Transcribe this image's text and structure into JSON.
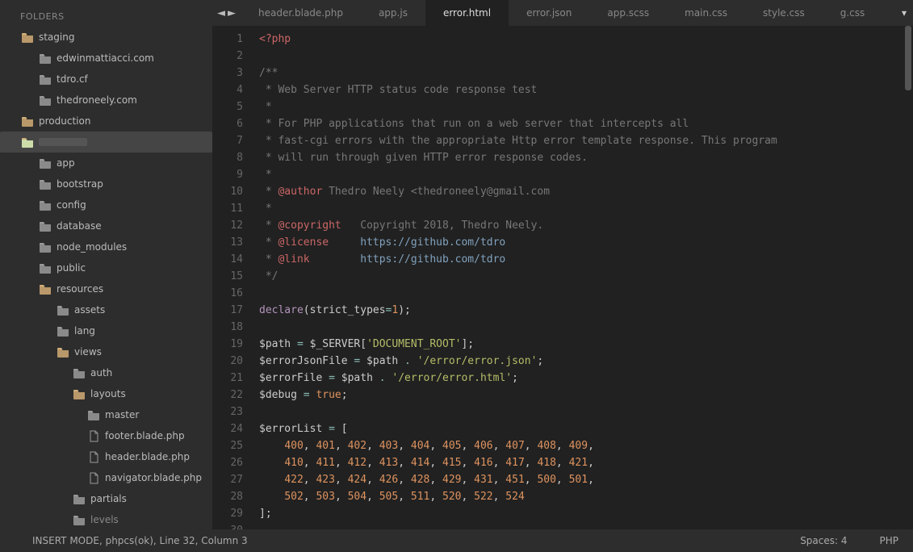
{
  "sidebar": {
    "title": "FOLDERS",
    "tree": [
      {
        "indent": 1,
        "type": "folder",
        "open": true,
        "label": "staging"
      },
      {
        "indent": 2,
        "type": "folder",
        "open": false,
        "label": "edwinmattiacci.com"
      },
      {
        "indent": 2,
        "type": "folder",
        "open": false,
        "label": "tdro.cf"
      },
      {
        "indent": 2,
        "type": "folder",
        "open": false,
        "label": "thedroneely.com"
      },
      {
        "indent": 1,
        "type": "folder",
        "open": true,
        "label": "production"
      },
      {
        "indent": 1,
        "type": "folder",
        "open": true,
        "label": "",
        "selected": true,
        "dimmed": true
      },
      {
        "indent": 2,
        "type": "folder",
        "open": false,
        "label": "app"
      },
      {
        "indent": 2,
        "type": "folder",
        "open": false,
        "label": "bootstrap"
      },
      {
        "indent": 2,
        "type": "folder",
        "open": false,
        "label": "config"
      },
      {
        "indent": 2,
        "type": "folder",
        "open": false,
        "label": "database"
      },
      {
        "indent": 2,
        "type": "folder",
        "open": false,
        "label": "node_modules"
      },
      {
        "indent": 2,
        "type": "folder",
        "open": false,
        "label": "public"
      },
      {
        "indent": 2,
        "type": "folder",
        "open": true,
        "label": "resources"
      },
      {
        "indent": 3,
        "type": "folder",
        "open": false,
        "label": "assets"
      },
      {
        "indent": 3,
        "type": "folder",
        "open": false,
        "label": "lang"
      },
      {
        "indent": 3,
        "type": "folder",
        "open": true,
        "label": "views"
      },
      {
        "indent": 4,
        "type": "folder",
        "open": false,
        "label": "auth"
      },
      {
        "indent": 4,
        "type": "folder",
        "open": true,
        "label": "layouts"
      },
      {
        "indent": 5,
        "type": "folder",
        "open": false,
        "label": "master"
      },
      {
        "indent": 5,
        "type": "file",
        "label": "footer.blade.php"
      },
      {
        "indent": 5,
        "type": "file",
        "label": "header.blade.php"
      },
      {
        "indent": 5,
        "type": "file",
        "label": "navigator.blade.php"
      },
      {
        "indent": 4,
        "type": "folder",
        "open": false,
        "label": "partials"
      },
      {
        "indent": 4,
        "type": "folder",
        "open": false,
        "label": "levels",
        "dimmed": true
      }
    ]
  },
  "tabs": {
    "nav_prev": "◄",
    "nav_next": "►",
    "items": [
      {
        "label": "header.blade.php",
        "active": false
      },
      {
        "label": "app.js",
        "active": false
      },
      {
        "label": "error.html",
        "active": true
      },
      {
        "label": "error.json",
        "active": false
      },
      {
        "label": "app.scss",
        "active": false
      },
      {
        "label": "main.css",
        "active": false
      },
      {
        "label": "style.css",
        "active": false
      },
      {
        "label": "g.css",
        "active": false
      }
    ],
    "overflow_glyph": "▾"
  },
  "editor": {
    "lines": [
      [
        {
          "t": "<?php",
          "c": "tok-tag"
        }
      ],
      [],
      [
        {
          "t": "/**",
          "c": "tok-comment"
        }
      ],
      [
        {
          "t": " * Web Server HTTP status code response test",
          "c": "tok-comment"
        }
      ],
      [
        {
          "t": " *",
          "c": "tok-comment"
        }
      ],
      [
        {
          "t": " * For PHP applications that run on a web server that intercepts all",
          "c": "tok-comment"
        }
      ],
      [
        {
          "t": " * fast-cgi errors with the appropriate Http error template response. This program",
          "c": "tok-comment"
        }
      ],
      [
        {
          "t": " * will run through given HTTP error response codes.",
          "c": "tok-comment"
        }
      ],
      [
        {
          "t": " *",
          "c": "tok-comment"
        }
      ],
      [
        {
          "t": " * ",
          "c": "tok-comment"
        },
        {
          "t": "@author",
          "c": "tok-doctag"
        },
        {
          "t": " Thedro Neely <thedroneely@gmail.com",
          "c": "tok-comment"
        }
      ],
      [
        {
          "t": " *",
          "c": "tok-comment"
        }
      ],
      [
        {
          "t": " * ",
          "c": "tok-comment"
        },
        {
          "t": "@copyright",
          "c": "tok-doctag"
        },
        {
          "t": "   Copyright 2018, Thedro Neely.",
          "c": "tok-comment"
        }
      ],
      [
        {
          "t": " * ",
          "c": "tok-comment"
        },
        {
          "t": "@license",
          "c": "tok-doctag"
        },
        {
          "t": "     ",
          "c": "tok-comment"
        },
        {
          "t": "https://github.com/tdro",
          "c": "tok-link"
        }
      ],
      [
        {
          "t": " * ",
          "c": "tok-comment"
        },
        {
          "t": "@link",
          "c": "tok-doctag"
        },
        {
          "t": "        ",
          "c": "tok-comment"
        },
        {
          "t": "https://github.com/tdro",
          "c": "tok-link"
        }
      ],
      [
        {
          "t": " */",
          "c": "tok-comment"
        }
      ],
      [],
      [
        {
          "t": "declare",
          "c": "tok-keyword"
        },
        {
          "t": "(",
          "c": "tok-punc"
        },
        {
          "t": "strict_types",
          "c": "tok-var"
        },
        {
          "t": "=",
          "c": "tok-op"
        },
        {
          "t": "1",
          "c": "tok-number"
        },
        {
          "t": ");",
          "c": "tok-punc"
        }
      ],
      [],
      [
        {
          "t": "$path",
          "c": "tok-var"
        },
        {
          "t": " ",
          "c": ""
        },
        {
          "t": "=",
          "c": "tok-op"
        },
        {
          "t": " $_SERVER[",
          "c": "tok-var"
        },
        {
          "t": "'DOCUMENT_ROOT'",
          "c": "tok-string"
        },
        {
          "t": "];",
          "c": "tok-punc"
        }
      ],
      [
        {
          "t": "$errorJsonFile",
          "c": "tok-var"
        },
        {
          "t": " ",
          "c": ""
        },
        {
          "t": "=",
          "c": "tok-op"
        },
        {
          "t": " $path ",
          "c": "tok-var"
        },
        {
          "t": ".",
          "c": "tok-op"
        },
        {
          "t": " ",
          "c": ""
        },
        {
          "t": "'/error/error.json'",
          "c": "tok-string"
        },
        {
          "t": ";",
          "c": "tok-punc"
        }
      ],
      [
        {
          "t": "$errorFile",
          "c": "tok-var"
        },
        {
          "t": " ",
          "c": ""
        },
        {
          "t": "=",
          "c": "tok-op"
        },
        {
          "t": " $path ",
          "c": "tok-var"
        },
        {
          "t": ".",
          "c": "tok-op"
        },
        {
          "t": " ",
          "c": ""
        },
        {
          "t": "'/error/error.html'",
          "c": "tok-string"
        },
        {
          "t": ";",
          "c": "tok-punc"
        }
      ],
      [
        {
          "t": "$debug",
          "c": "tok-var"
        },
        {
          "t": " ",
          "c": ""
        },
        {
          "t": "=",
          "c": "tok-op"
        },
        {
          "t": " ",
          "c": ""
        },
        {
          "t": "true",
          "c": "tok-bool"
        },
        {
          "t": ";",
          "c": "tok-punc"
        }
      ],
      [],
      [
        {
          "t": "$errorList",
          "c": "tok-var"
        },
        {
          "t": " ",
          "c": ""
        },
        {
          "t": "=",
          "c": "tok-op"
        },
        {
          "t": " [",
          "c": "tok-punc"
        }
      ],
      [
        {
          "t": "    ",
          "c": ""
        },
        {
          "t": "400",
          "c": "tok-number"
        },
        {
          "t": ", ",
          "c": "tok-punc"
        },
        {
          "t": "401",
          "c": "tok-number"
        },
        {
          "t": ", ",
          "c": "tok-punc"
        },
        {
          "t": "402",
          "c": "tok-number"
        },
        {
          "t": ", ",
          "c": "tok-punc"
        },
        {
          "t": "403",
          "c": "tok-number"
        },
        {
          "t": ", ",
          "c": "tok-punc"
        },
        {
          "t": "404",
          "c": "tok-number"
        },
        {
          "t": ", ",
          "c": "tok-punc"
        },
        {
          "t": "405",
          "c": "tok-number"
        },
        {
          "t": ", ",
          "c": "tok-punc"
        },
        {
          "t": "406",
          "c": "tok-number"
        },
        {
          "t": ", ",
          "c": "tok-punc"
        },
        {
          "t": "407",
          "c": "tok-number"
        },
        {
          "t": ", ",
          "c": "tok-punc"
        },
        {
          "t": "408",
          "c": "tok-number"
        },
        {
          "t": ", ",
          "c": "tok-punc"
        },
        {
          "t": "409",
          "c": "tok-number"
        },
        {
          "t": ",",
          "c": "tok-punc"
        }
      ],
      [
        {
          "t": "    ",
          "c": ""
        },
        {
          "t": "410",
          "c": "tok-number"
        },
        {
          "t": ", ",
          "c": "tok-punc"
        },
        {
          "t": "411",
          "c": "tok-number"
        },
        {
          "t": ", ",
          "c": "tok-punc"
        },
        {
          "t": "412",
          "c": "tok-number"
        },
        {
          "t": ", ",
          "c": "tok-punc"
        },
        {
          "t": "413",
          "c": "tok-number"
        },
        {
          "t": ", ",
          "c": "tok-punc"
        },
        {
          "t": "414",
          "c": "tok-number"
        },
        {
          "t": ", ",
          "c": "tok-punc"
        },
        {
          "t": "415",
          "c": "tok-number"
        },
        {
          "t": ", ",
          "c": "tok-punc"
        },
        {
          "t": "416",
          "c": "tok-number"
        },
        {
          "t": ", ",
          "c": "tok-punc"
        },
        {
          "t": "417",
          "c": "tok-number"
        },
        {
          "t": ", ",
          "c": "tok-punc"
        },
        {
          "t": "418",
          "c": "tok-number"
        },
        {
          "t": ", ",
          "c": "tok-punc"
        },
        {
          "t": "421",
          "c": "tok-number"
        },
        {
          "t": ",",
          "c": "tok-punc"
        }
      ],
      [
        {
          "t": "    ",
          "c": ""
        },
        {
          "t": "422",
          "c": "tok-number"
        },
        {
          "t": ", ",
          "c": "tok-punc"
        },
        {
          "t": "423",
          "c": "tok-number"
        },
        {
          "t": ", ",
          "c": "tok-punc"
        },
        {
          "t": "424",
          "c": "tok-number"
        },
        {
          "t": ", ",
          "c": "tok-punc"
        },
        {
          "t": "426",
          "c": "tok-number"
        },
        {
          "t": ", ",
          "c": "tok-punc"
        },
        {
          "t": "428",
          "c": "tok-number"
        },
        {
          "t": ", ",
          "c": "tok-punc"
        },
        {
          "t": "429",
          "c": "tok-number"
        },
        {
          "t": ", ",
          "c": "tok-punc"
        },
        {
          "t": "431",
          "c": "tok-number"
        },
        {
          "t": ", ",
          "c": "tok-punc"
        },
        {
          "t": "451",
          "c": "tok-number"
        },
        {
          "t": ", ",
          "c": "tok-punc"
        },
        {
          "t": "500",
          "c": "tok-number"
        },
        {
          "t": ", ",
          "c": "tok-punc"
        },
        {
          "t": "501",
          "c": "tok-number"
        },
        {
          "t": ",",
          "c": "tok-punc"
        }
      ],
      [
        {
          "t": "    ",
          "c": ""
        },
        {
          "t": "502",
          "c": "tok-number"
        },
        {
          "t": ", ",
          "c": "tok-punc"
        },
        {
          "t": "503",
          "c": "tok-number"
        },
        {
          "t": ", ",
          "c": "tok-punc"
        },
        {
          "t": "504",
          "c": "tok-number"
        },
        {
          "t": ", ",
          "c": "tok-punc"
        },
        {
          "t": "505",
          "c": "tok-number"
        },
        {
          "t": ", ",
          "c": "tok-punc"
        },
        {
          "t": "511",
          "c": "tok-number"
        },
        {
          "t": ", ",
          "c": "tok-punc"
        },
        {
          "t": "520",
          "c": "tok-number"
        },
        {
          "t": ", ",
          "c": "tok-punc"
        },
        {
          "t": "522",
          "c": "tok-number"
        },
        {
          "t": ", ",
          "c": "tok-punc"
        },
        {
          "t": "524",
          "c": "tok-number"
        }
      ],
      [
        {
          "t": "];",
          "c": "tok-punc"
        }
      ],
      []
    ]
  },
  "status": {
    "left": "INSERT MODE, phpcs(ok), Line 32, Column 3",
    "spaces": "Spaces: 4",
    "lang": "PHP"
  }
}
